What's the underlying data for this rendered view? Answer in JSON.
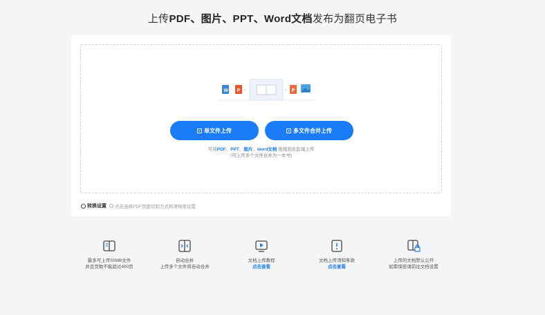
{
  "header": {
    "title_prefix": "上传",
    "title_bold_1": "PDF、图片、PPT、Word文档",
    "title_suffix": "发布为翻页电子书"
  },
  "upload": {
    "single_button": "单文件上传",
    "multi_button": "多文件合并上传",
    "hint_prefix": "可将",
    "hint_pdf": "PDF",
    "hint_sep1": "、",
    "hint_ppt": "PPT",
    "hint_sep2": "、",
    "hint_img": "图片",
    "hint_sep3": "、",
    "hint_word": "word文档",
    "hint_suffix": " 拖拽到此区域上传",
    "hint_line2": "(可上传多个文件合并为一本书)"
  },
  "settings": {
    "label": "转换设置",
    "tip": "点击选择PDF页面切割方式和清晰度设置"
  },
  "features": [
    {
      "icon": "book-icon",
      "line1": "最多可上传50MB文件",
      "line2": "并且页数不能超过400页",
      "link": ""
    },
    {
      "icon": "merge-icon",
      "line1": "自动合并",
      "line2": "上传多个文件将自动合并",
      "link": ""
    },
    {
      "icon": "video-icon",
      "line1": "文档上传教程",
      "line2": "",
      "link": "点击查看"
    },
    {
      "icon": "notice-icon",
      "line1": "文档上传须知条款",
      "line2": "",
      "link": "点击查看"
    },
    {
      "icon": "lock-book-icon",
      "line1": "上传的文档默认公开",
      "line2": "如需保密请前往文档设置",
      "link": ""
    }
  ],
  "colors": {
    "accent": "#1a7cf7",
    "background": "#f4f5f7"
  }
}
